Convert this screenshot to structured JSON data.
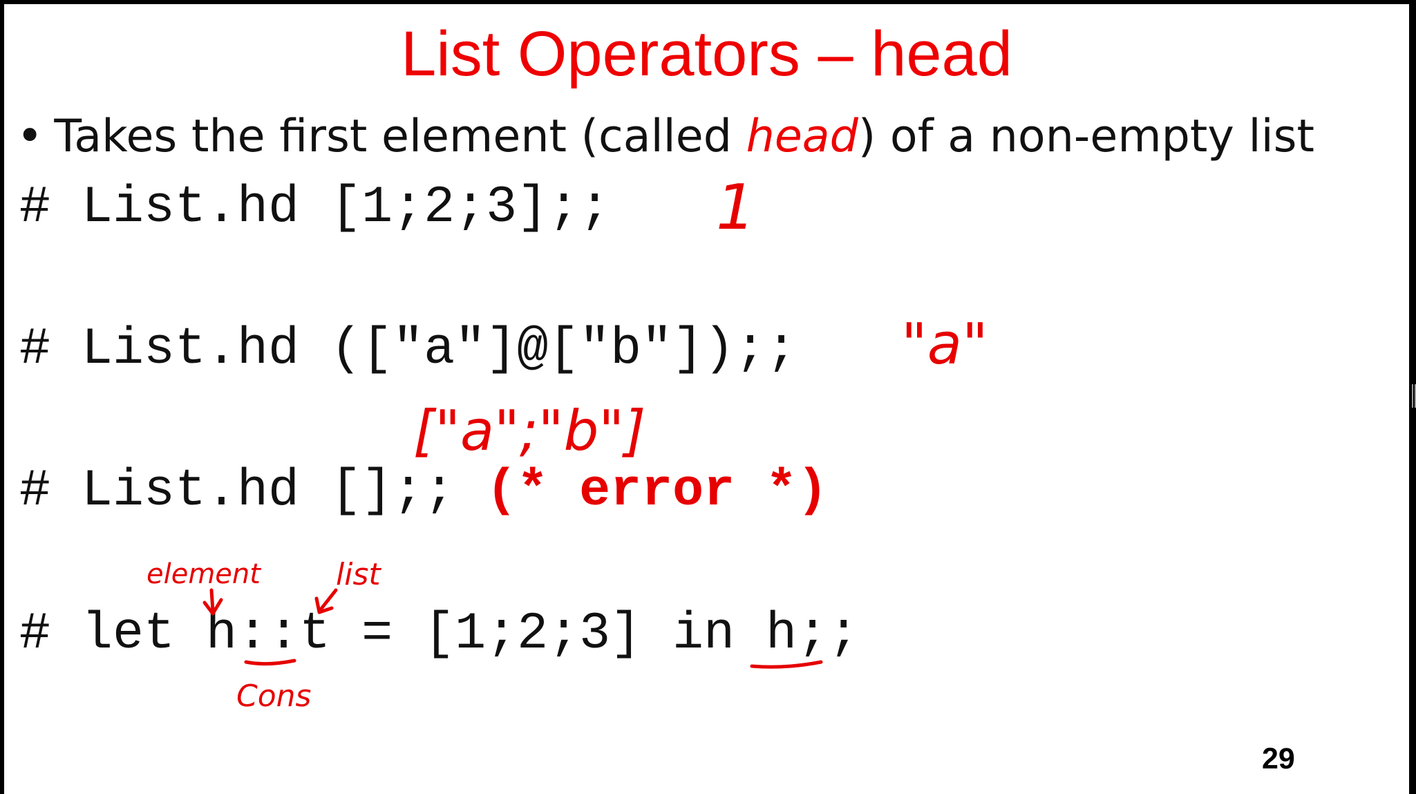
{
  "slide": {
    "title": "List Operators – head",
    "bullet": {
      "marker": "•",
      "text_before": "Takes the first element (called ",
      "emphasis": "head",
      "text_after": ") of a non-empty list"
    },
    "code_lines": [
      "# List.hd [1;2;3];;",
      "# List.hd ([\"a\"]@[\"b\"]);;",
      "# List.hd [];;",
      "# let h::t = [1;2;3] in h;;"
    ],
    "error_comment": "(* error *)",
    "page_number": "29"
  },
  "annotations": {
    "result_1": "1",
    "result_2": "\"a\"",
    "concat_result": "[\"a\";\"b\"]",
    "element_label": "element",
    "list_label": "list",
    "cons_label": "Cons"
  },
  "colors": {
    "title": "#ee0000",
    "ink": "#e60000",
    "text": "#111111",
    "frame": "#000000"
  }
}
